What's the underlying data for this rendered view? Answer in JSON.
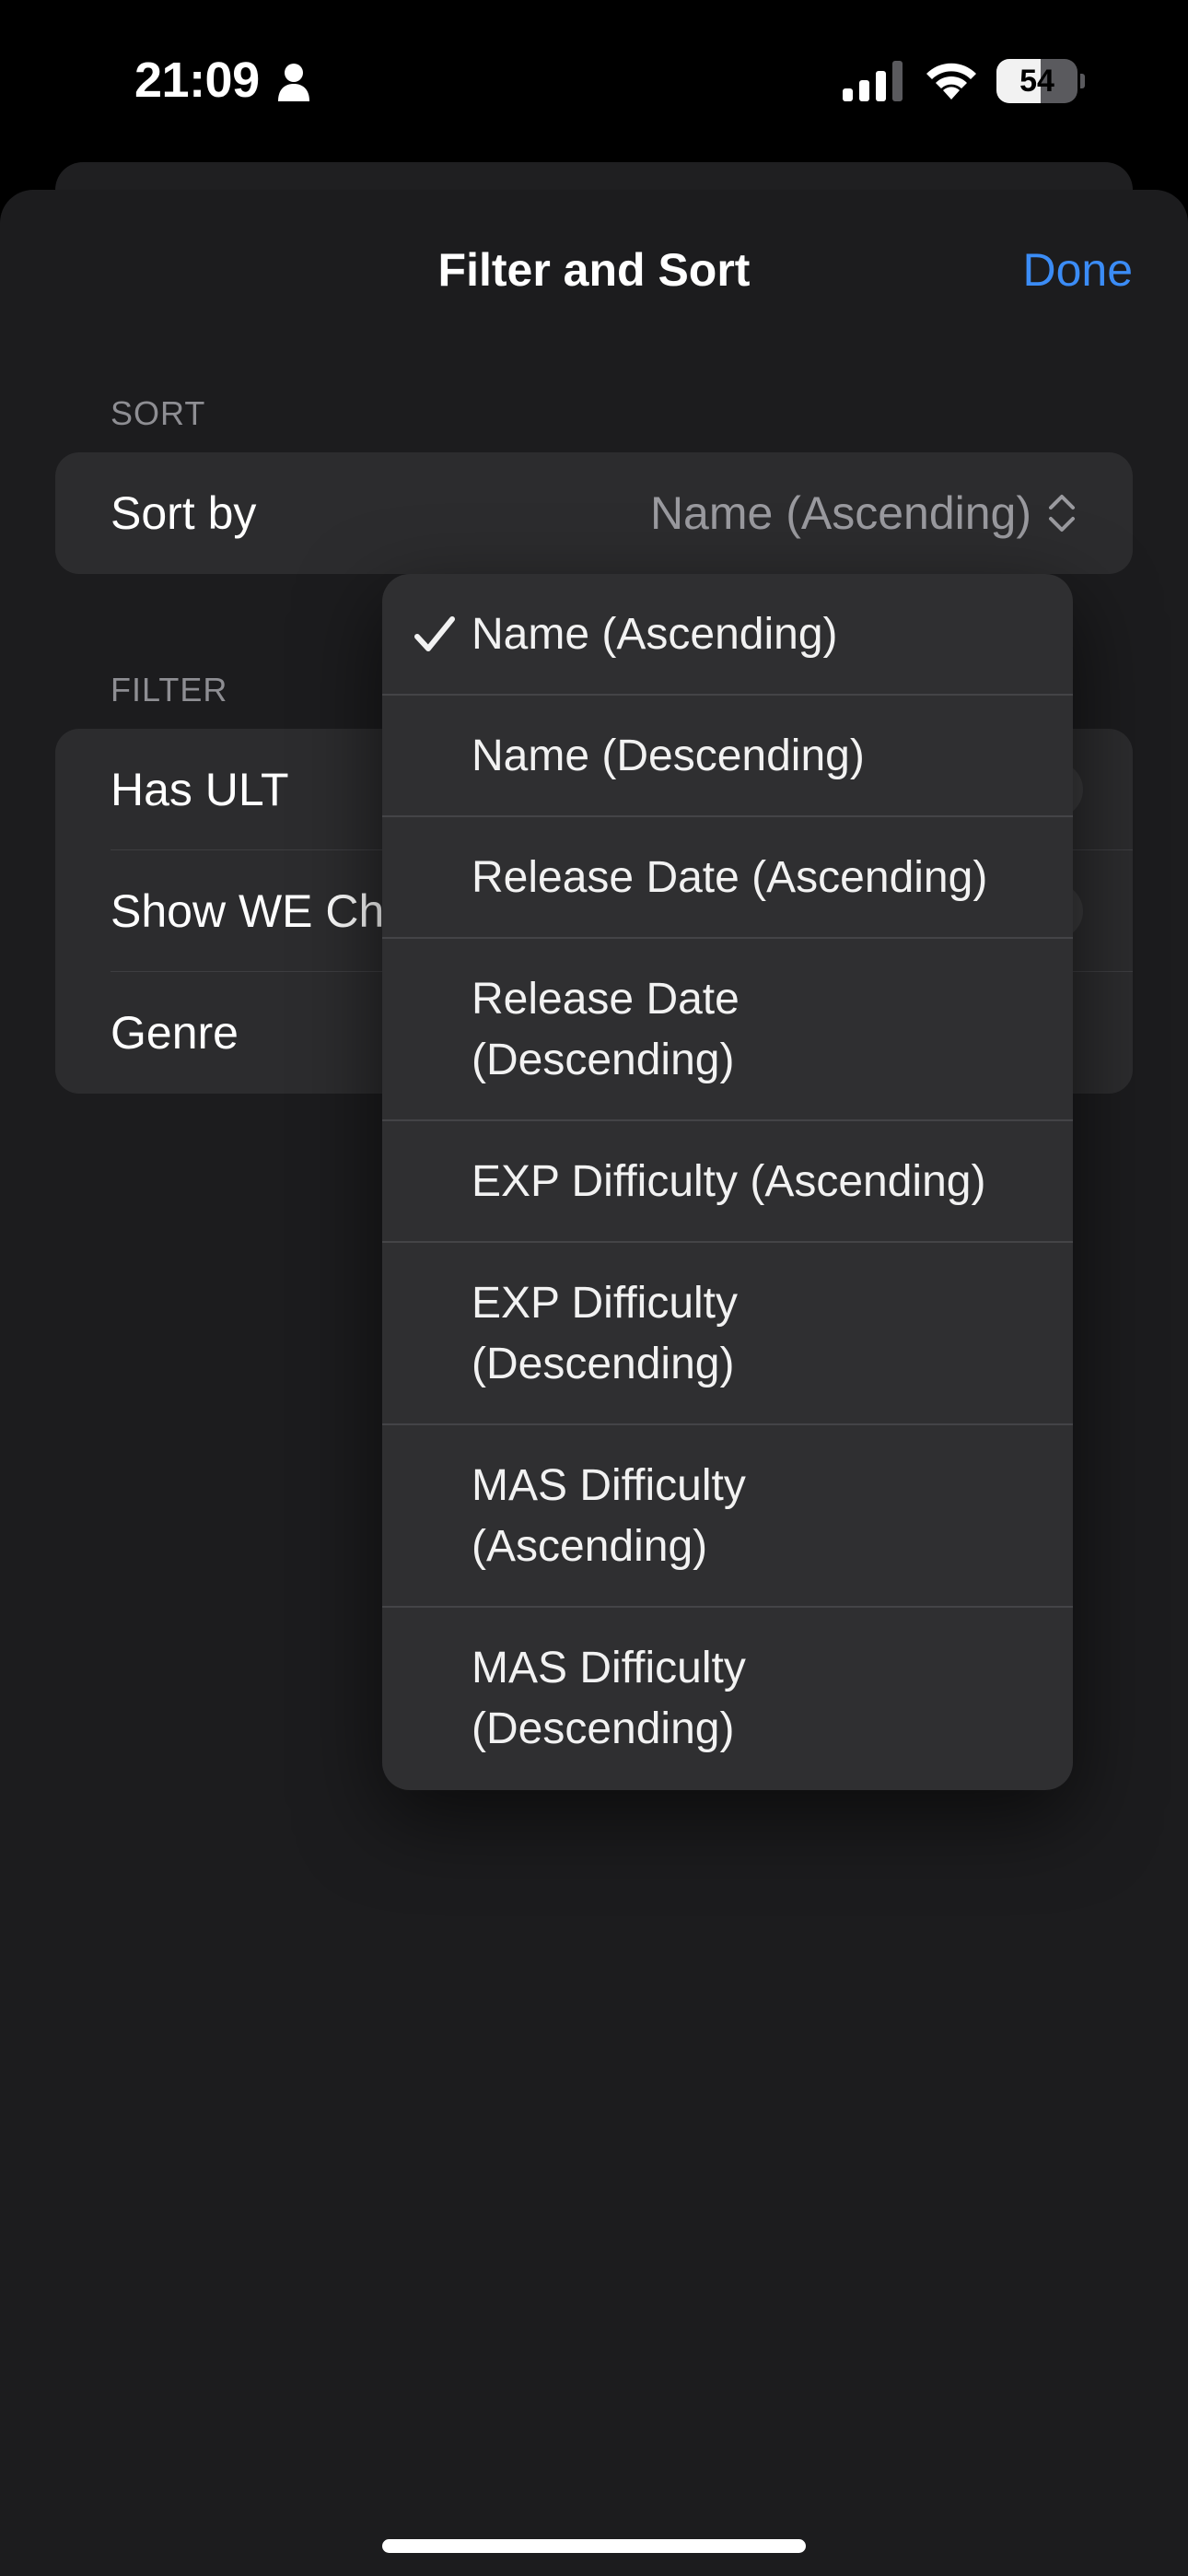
{
  "status_bar": {
    "time": "21:09",
    "battery_percent": "54",
    "battery_level": 0.54
  },
  "sheet": {
    "title": "Filter and Sort",
    "done_label": "Done"
  },
  "sort_section": {
    "header": "SORT",
    "sort_by_label": "Sort by",
    "sort_by_value": "Name (Ascending)"
  },
  "filter_section": {
    "header": "FILTER",
    "rows": [
      {
        "label": "Has ULT"
      },
      {
        "label": "Show WE Ch"
      },
      {
        "label": "Genre"
      }
    ]
  },
  "menu": {
    "items": [
      {
        "label": "Name (Ascending)",
        "selected": true
      },
      {
        "label": "Name (Descending)",
        "selected": false
      },
      {
        "label": "Release Date (Ascending)",
        "selected": false
      },
      {
        "label": "Release Date\n(Descending)",
        "selected": false
      },
      {
        "label": "EXP Difficulty (Ascending)",
        "selected": false
      },
      {
        "label": "EXP Difficulty\n(Descending)",
        "selected": false
      },
      {
        "label": "MAS Difficulty\n(Ascending)",
        "selected": false
      },
      {
        "label": "MAS Difficulty\n(Descending)",
        "selected": false
      }
    ]
  },
  "colors": {
    "accent": "#3b8cf6",
    "sheet_bg": "#1c1c1e",
    "group_bg": "#2c2c2e",
    "menu_bg": "#2f2f31"
  }
}
